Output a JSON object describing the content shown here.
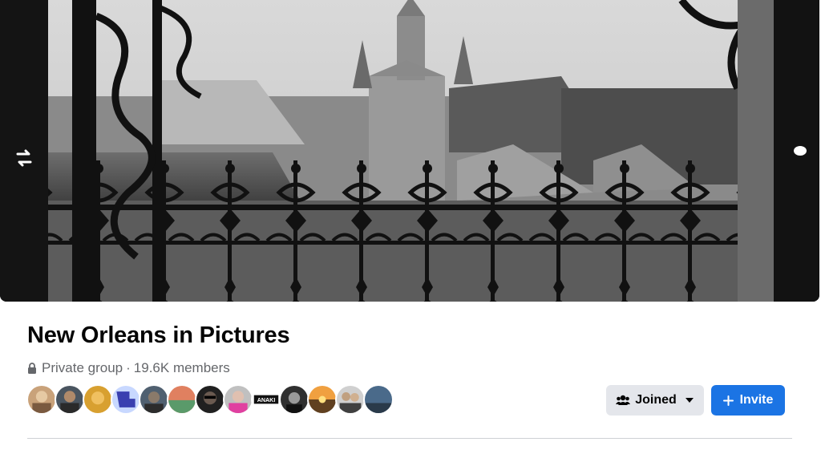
{
  "group": {
    "name": "New Orleans in Pictures",
    "privacy": "Private group",
    "separator": "·",
    "members": "19.6K members"
  },
  "icons": {
    "privacy": "lock-icon",
    "joined": "people-icon",
    "joined_menu": "caret-down-icon",
    "invite": "plus-icon"
  },
  "actions": {
    "joined_label": "Joined",
    "invite_label": "Invite"
  },
  "avatars": {
    "count": 13,
    "badge_text": "ANAKI"
  },
  "colors": {
    "primary": "#1b74e4",
    "secondary_button": "#e4e6eb",
    "title_text": "#050505",
    "meta_text": "#65676b"
  }
}
